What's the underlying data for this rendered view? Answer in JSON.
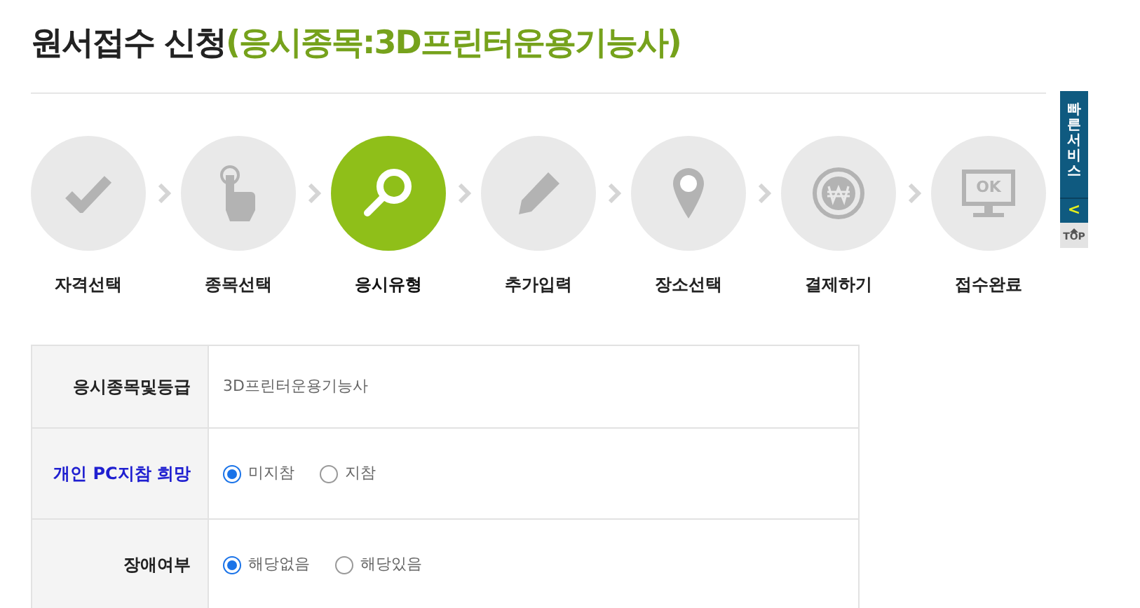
{
  "title": {
    "main": "원서접수 신청",
    "sub": "(응시종목:3D프린터운용기능사)"
  },
  "steps": [
    {
      "kind": "check",
      "label": "자격선택",
      "selected": false
    },
    {
      "kind": "hand",
      "label": "종목선택",
      "selected": false
    },
    {
      "kind": "search",
      "label": "응시유형",
      "selected": true
    },
    {
      "kind": "pencil",
      "label": "추가입력",
      "selected": false
    },
    {
      "kind": "pin",
      "label": "장소선택",
      "selected": false
    },
    {
      "kind": "coin",
      "label": "결제하기",
      "selected": false
    },
    {
      "kind": "monitor",
      "label": "접수완료",
      "selected": false,
      "screen_text": "OK"
    }
  ],
  "quick_service": {
    "label": "빠른서비스",
    "collapse": "<",
    "top": "TOP"
  },
  "form": [
    {
      "kind": "text",
      "label": "응시종목및등급",
      "emphasized": false,
      "value": "3D프린터운용기능사"
    },
    {
      "kind": "radio",
      "label": "개인 PC지참 희망",
      "emphasized": true,
      "options": [
        {
          "label": "미지참",
          "selected": true
        },
        {
          "label": "지참",
          "selected": false
        }
      ]
    },
    {
      "kind": "radio",
      "label": "장애여부",
      "emphasized": false,
      "options": [
        {
          "label": "해당없음",
          "selected": true
        },
        {
          "label": "해당있음",
          "selected": false
        }
      ]
    }
  ]
}
